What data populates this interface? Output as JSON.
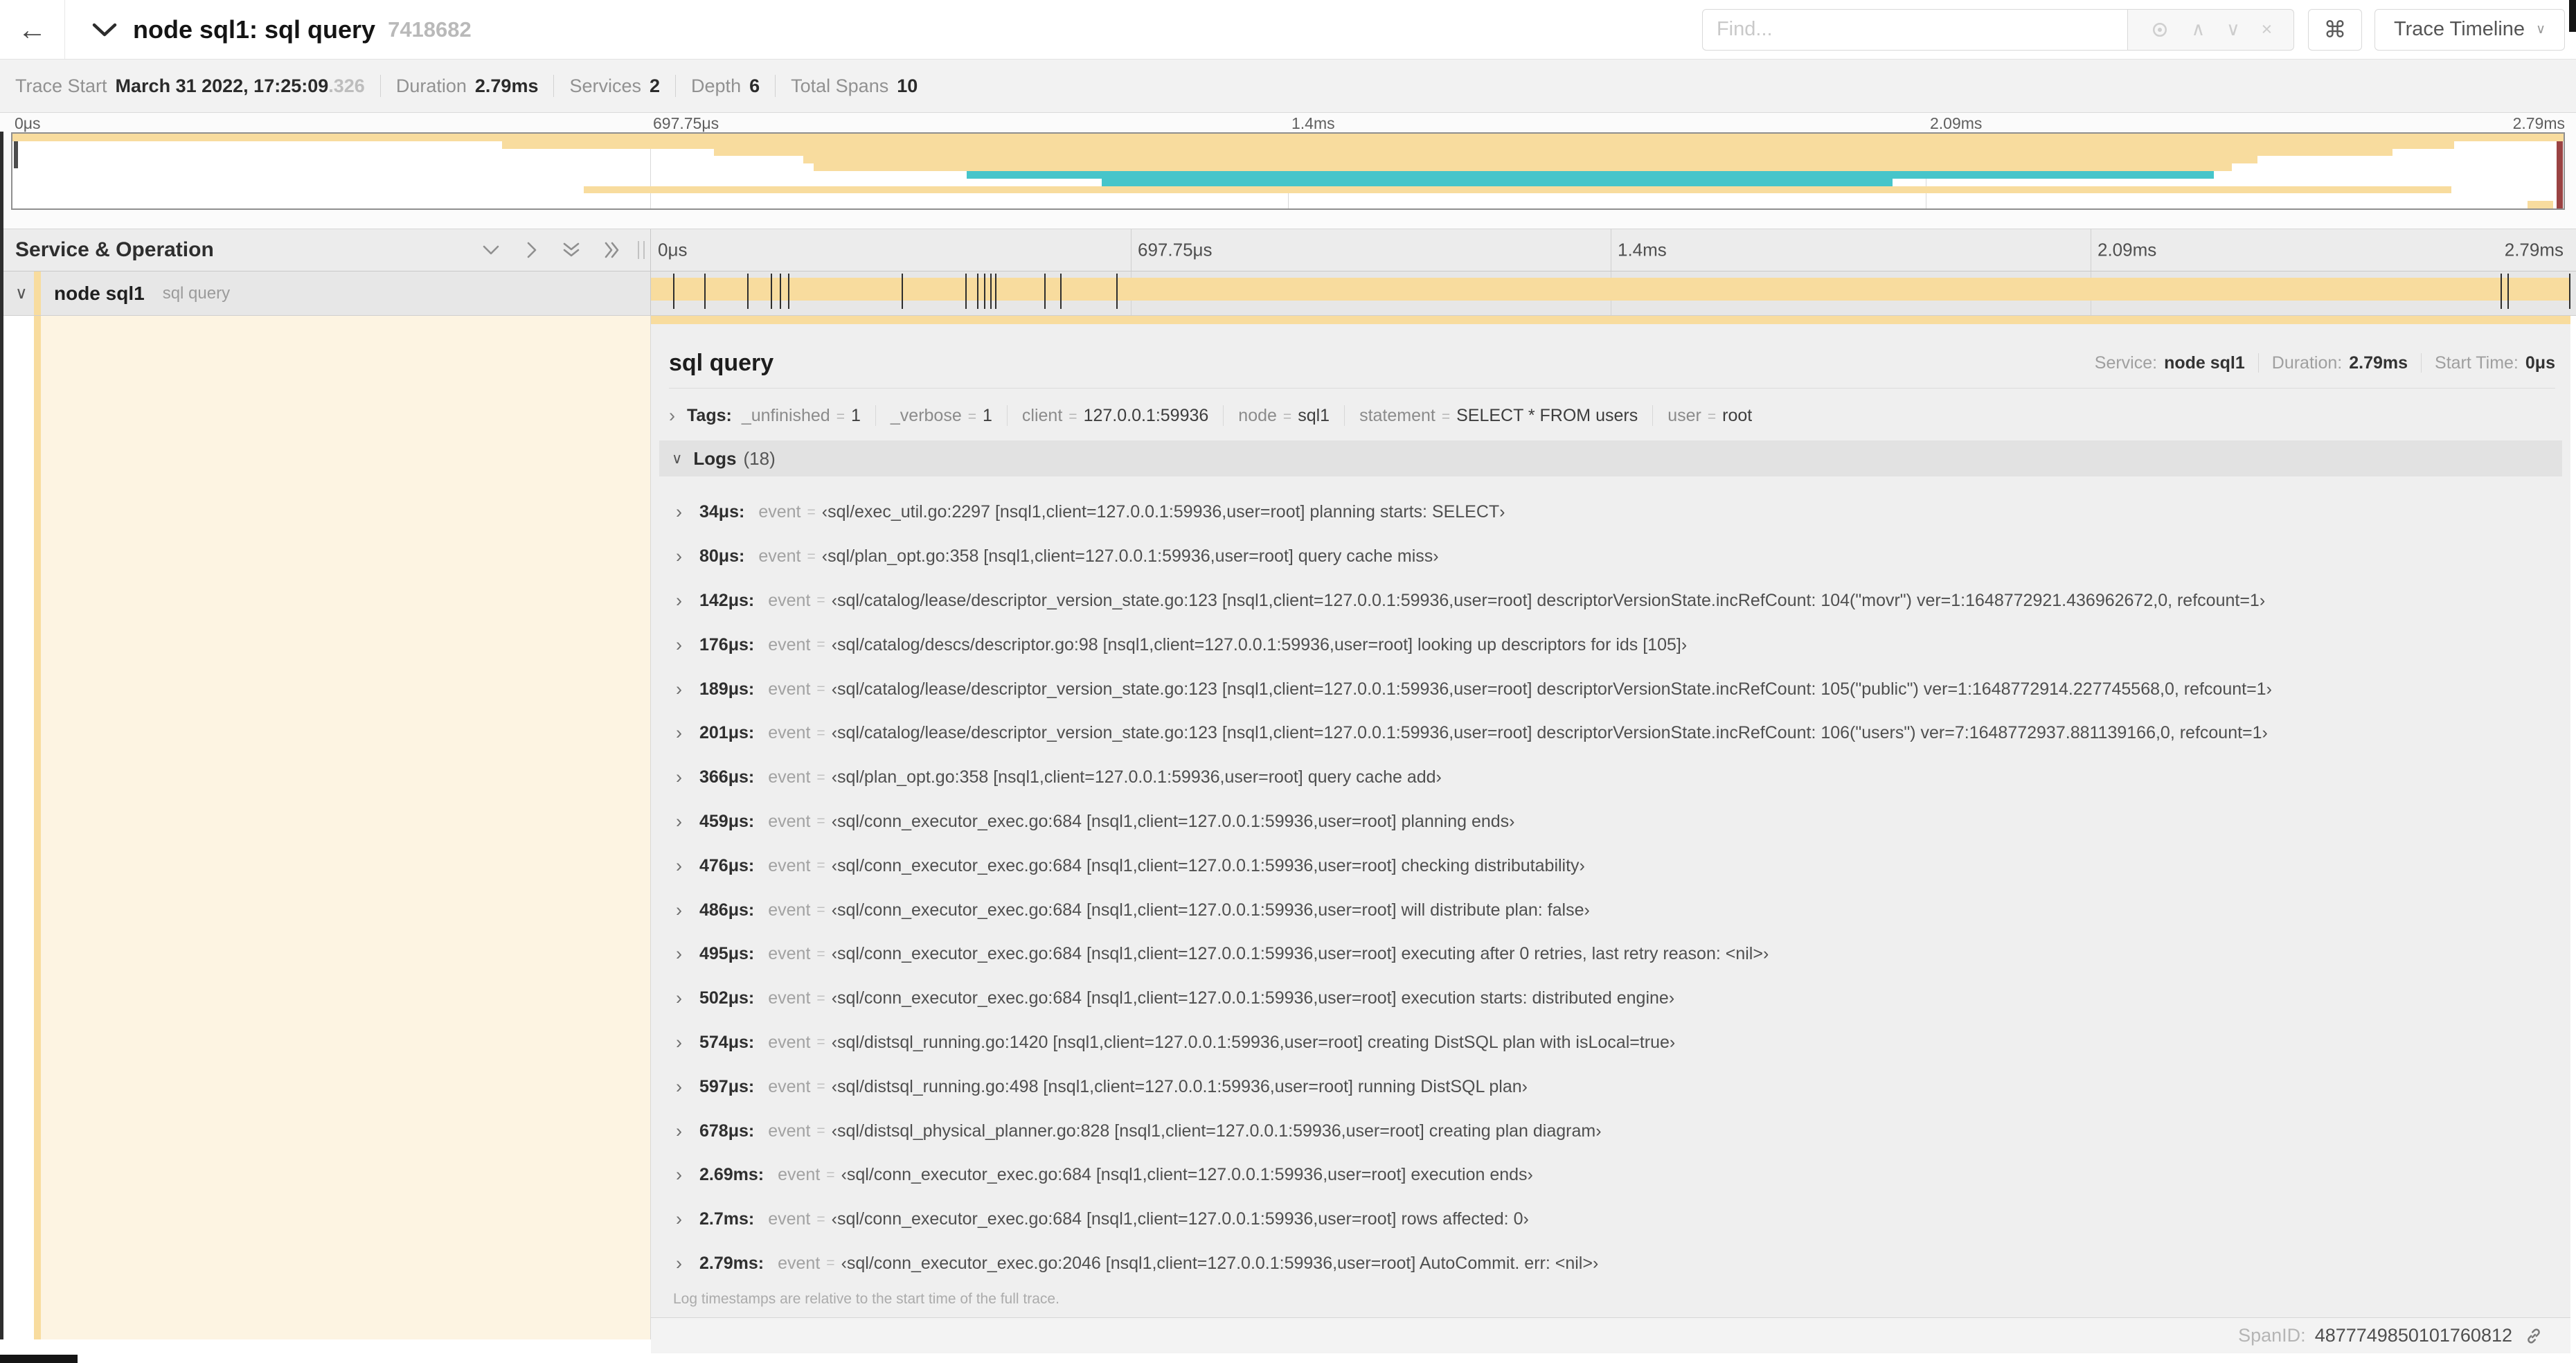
{
  "colors": {
    "tan": "#f8dc9e",
    "teal": "#46c5ca",
    "cream": "#fdf4e2",
    "scrubber": "#9a4343"
  },
  "icons": {
    "back": "←",
    "expander_collapsed": "›",
    "expander_expanded": "∨",
    "find_prev": "∧",
    "find_next": "∨",
    "find_clear": "×",
    "dropdown_caret": "∨"
  },
  "header": {
    "title": "node sql1: sql query",
    "trace_id": "7418682",
    "find": {
      "placeholder": "Find..."
    },
    "buttons": {
      "keyboard_shortcut": "⌘",
      "view_selector": "Trace Timeline"
    }
  },
  "trace_info": {
    "items": [
      {
        "label": "Trace Start",
        "value": "March 31 2022, 17:25:09",
        "value_dim": ".326"
      },
      {
        "label": "Duration",
        "value": "2.79ms"
      },
      {
        "label": "Services",
        "value": "2"
      },
      {
        "label": "Depth",
        "value": "6"
      },
      {
        "label": "Total Spans",
        "value": "10"
      }
    ]
  },
  "minimap": {
    "axis_ticks": [
      {
        "label": "0μs",
        "pct": 0
      },
      {
        "label": "697.75μs",
        "pct": 25
      },
      {
        "label": "1.4ms",
        "pct": 50
      },
      {
        "label": "2.09ms",
        "pct": 75
      },
      {
        "label": "2.79ms",
        "pct": 100
      }
    ],
    "spans": [
      {
        "row": 0,
        "start_pct": 0,
        "end_pct": 100,
        "color": "tan"
      },
      {
        "row": 1,
        "start_pct": 19.2,
        "end_pct": 95.7,
        "color": "tan"
      },
      {
        "row": 2,
        "start_pct": 27.5,
        "end_pct": 93.3,
        "color": "tan"
      },
      {
        "row": 3,
        "start_pct": 31.0,
        "end_pct": 88.0,
        "color": "tan"
      },
      {
        "row": 4,
        "start_pct": 31.4,
        "end_pct": 87.0,
        "color": "tan"
      },
      {
        "row": 5,
        "start_pct": 37.4,
        "end_pct": 86.3,
        "color": "teal"
      },
      {
        "row": 6,
        "start_pct": 42.7,
        "end_pct": 73.7,
        "color": "teal"
      },
      {
        "row": 7,
        "start_pct": 22.4,
        "end_pct": 95.6,
        "color": "tan"
      },
      {
        "row": 9,
        "start_pct": 98.6,
        "end_pct": 99.6,
        "color": "tan"
      }
    ]
  },
  "timeline": {
    "header_title": "Service & Operation",
    "axis_ticks": [
      {
        "label": "0μs",
        "pct": 0
      },
      {
        "label": "697.75μs",
        "pct": 25
      },
      {
        "label": "1.4ms",
        "pct": 50
      },
      {
        "label": "2.09ms",
        "pct": 75
      },
      {
        "label": "2.79ms",
        "pct": 100
      }
    ],
    "span_row": {
      "service": "node sql1",
      "operation": "sql query"
    }
  },
  "span_detail": {
    "title": "sql query",
    "overview": [
      {
        "label": "Service:",
        "value": "node sql1"
      },
      {
        "label": "Duration:",
        "value": "2.79ms"
      },
      {
        "label": "Start Time:",
        "value": "0μs"
      }
    ],
    "tags_label": "Tags:",
    "eq_sign": "=",
    "tags": [
      {
        "key": "_unfinished",
        "value": "1"
      },
      {
        "key": "_verbose",
        "value": "1"
      },
      {
        "key": "client",
        "value": "127.0.0.1:59936"
      },
      {
        "key": "node",
        "value": "sql1"
      },
      {
        "key": "statement",
        "value": "SELECT * FROM users"
      },
      {
        "key": "user",
        "value": "root"
      }
    ],
    "logs_label": "Logs",
    "logs_count": "(18)",
    "log_field_key": "event",
    "duration_us": 2790,
    "logs": [
      {
        "time": "34μs:",
        "us": 34,
        "event": "‹sql/exec_util.go:2297 [nsql1,client=127.0.0.1:59936,user=root] planning starts: SELECT›"
      },
      {
        "time": "80μs:",
        "us": 80,
        "event": "‹sql/plan_opt.go:358 [nsql1,client=127.0.0.1:59936,user=root] query cache miss›"
      },
      {
        "time": "142μs:",
        "us": 142,
        "event": "‹sql/catalog/lease/descriptor_version_state.go:123 [nsql1,client=127.0.0.1:59936,user=root] descriptorVersionState.incRefCount: 104(\"movr\") ver=1:1648772921.436962672,0, refcount=1›"
      },
      {
        "time": "176μs:",
        "us": 176,
        "event": "‹sql/catalog/descs/descriptor.go:98 [nsql1,client=127.0.0.1:59936,user=root] looking up descriptors for ids [105]›"
      },
      {
        "time": "189μs:",
        "us": 189,
        "event": "‹sql/catalog/lease/descriptor_version_state.go:123 [nsql1,client=127.0.0.1:59936,user=root] descriptorVersionState.incRefCount: 105(\"public\") ver=1:1648772914.227745568,0, refcount=1›"
      },
      {
        "time": "201μs:",
        "us": 201,
        "event": "‹sql/catalog/lease/descriptor_version_state.go:123 [nsql1,client=127.0.0.1:59936,user=root] descriptorVersionState.incRefCount: 106(\"users\") ver=7:1648772937.881139166,0, refcount=1›"
      },
      {
        "time": "366μs:",
        "us": 366,
        "event": "‹sql/plan_opt.go:358 [nsql1,client=127.0.0.1:59936,user=root] query cache add›"
      },
      {
        "time": "459μs:",
        "us": 459,
        "event": "‹sql/conn_executor_exec.go:684 [nsql1,client=127.0.0.1:59936,user=root] planning ends›"
      },
      {
        "time": "476μs:",
        "us": 476,
        "event": "‹sql/conn_executor_exec.go:684 [nsql1,client=127.0.0.1:59936,user=root] checking distributability›"
      },
      {
        "time": "486μs:",
        "us": 486,
        "event": "‹sql/conn_executor_exec.go:684 [nsql1,client=127.0.0.1:59936,user=root] will distribute plan: false›"
      },
      {
        "time": "495μs:",
        "us": 495,
        "event": "‹sql/conn_executor_exec.go:684 [nsql1,client=127.0.0.1:59936,user=root] executing after 0 retries, last retry reason: <nil>›"
      },
      {
        "time": "502μs:",
        "us": 502,
        "event": "‹sql/conn_executor_exec.go:684 [nsql1,client=127.0.0.1:59936,user=root] execution starts: distributed engine›"
      },
      {
        "time": "574μs:",
        "us": 574,
        "event": "‹sql/distsql_running.go:1420 [nsql1,client=127.0.0.1:59936,user=root] creating DistSQL plan with isLocal=true›"
      },
      {
        "time": "597μs:",
        "us": 597,
        "event": "‹sql/distsql_running.go:498 [nsql1,client=127.0.0.1:59936,user=root] running DistSQL plan›"
      },
      {
        "time": "678μs:",
        "us": 678,
        "event": "‹sql/distsql_physical_planner.go:828 [nsql1,client=127.0.0.1:59936,user=root] creating plan diagram›"
      },
      {
        "time": "2.69ms:",
        "us": 2690,
        "event": "‹sql/conn_executor_exec.go:684 [nsql1,client=127.0.0.1:59936,user=root] execution ends›"
      },
      {
        "time": "2.7ms:",
        "us": 2700,
        "event": "‹sql/conn_executor_exec.go:684 [nsql1,client=127.0.0.1:59936,user=root] rows affected: 0›"
      },
      {
        "time": "2.79ms:",
        "us": 2790,
        "event": "‹sql/conn_executor_exec.go:2046 [nsql1,client=127.0.0.1:59936,user=root] AutoCommit. err: <nil>›"
      }
    ],
    "logs_note": "Log timestamps are relative to the start time of the full trace.",
    "span_id_label": "SpanID:",
    "span_id": "4877749850101760812"
  }
}
